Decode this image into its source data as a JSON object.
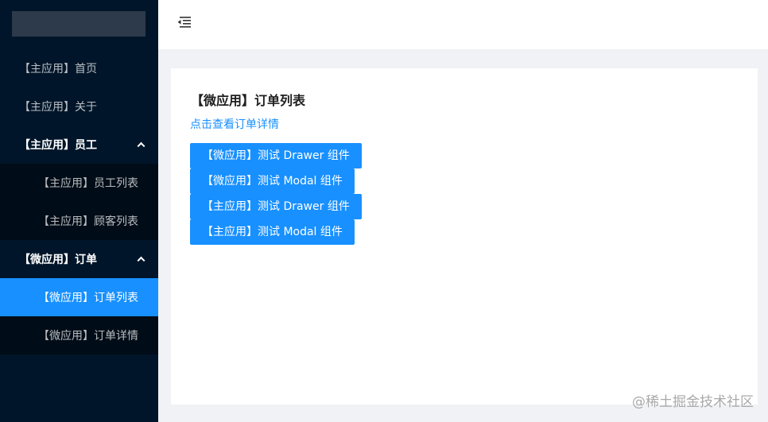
{
  "sidebar": {
    "items": [
      {
        "label": "【主应用】首页"
      },
      {
        "label": "【主应用】关于"
      },
      {
        "label": "【主应用】员工",
        "children": [
          {
            "label": "【主应用】员工列表"
          },
          {
            "label": "【主应用】顾客列表"
          }
        ]
      },
      {
        "label": "【微应用】订单",
        "children": [
          {
            "label": "【微应用】订单列表"
          },
          {
            "label": "【微应用】订单详情"
          }
        ]
      }
    ],
    "selected": "【微应用】订单列表"
  },
  "header": {
    "fold_icon": "menu-fold-icon"
  },
  "main": {
    "title": "【微应用】订单列表",
    "detail_link": "点击查看订单详情",
    "buttons": [
      {
        "label": "【微应用】测试 Drawer 组件"
      },
      {
        "label": "【微应用】测试 Modal 组件"
      },
      {
        "label": "【主应用】测试 Drawer 组件"
      },
      {
        "label": "【主应用】测试 Modal 组件"
      }
    ]
  },
  "watermark": "@稀土掘金技术社区",
  "colors": {
    "sider_bg": "#001529",
    "submenu_bg": "#000c17",
    "primary": "#1890ff",
    "page_bg": "#f0f2f5"
  }
}
